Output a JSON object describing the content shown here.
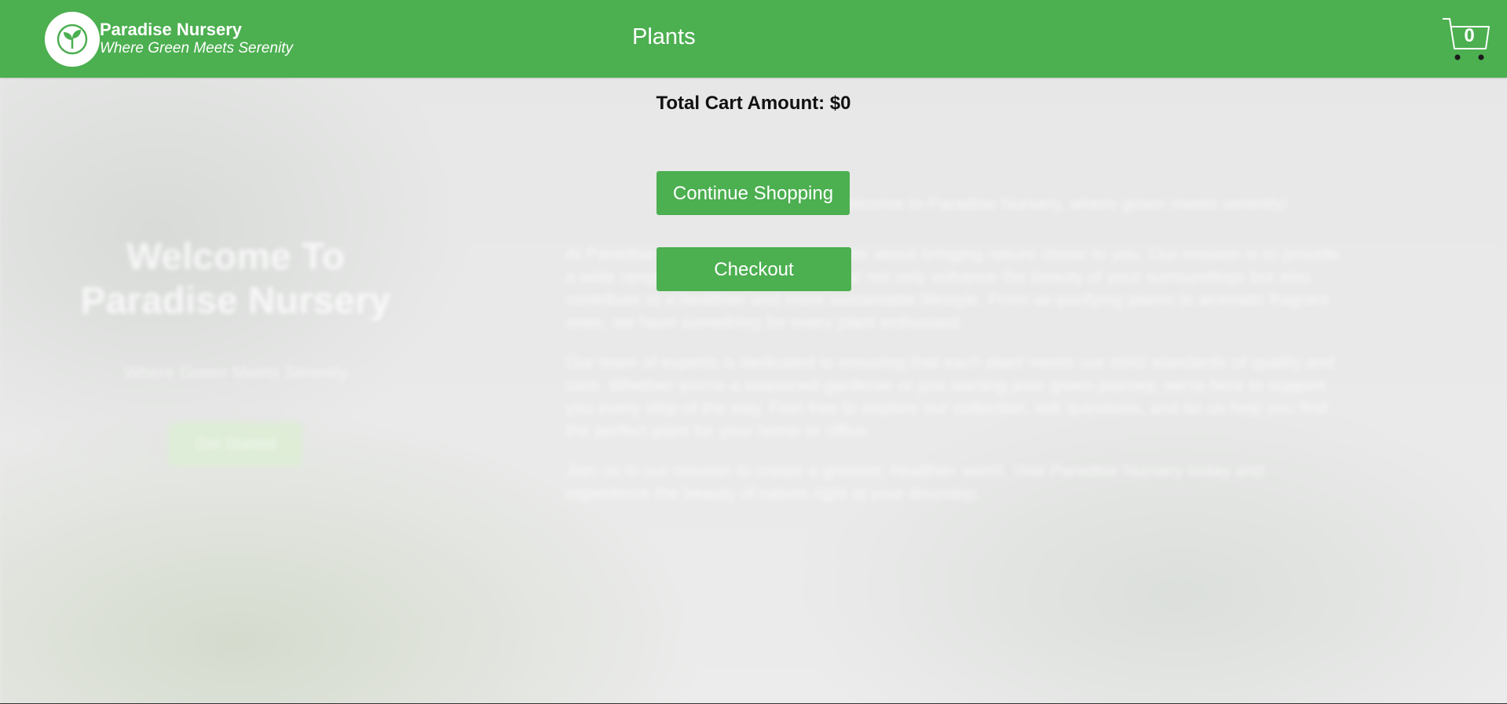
{
  "header": {
    "brand_name": "Paradise Nursery",
    "brand_tagline": "Where Green Meets Serenity",
    "nav_plants": "Plants",
    "cart_count": "0",
    "logo_icon": "seedling-icon",
    "cart_icon": "shopping-cart-icon",
    "color": "#4caf50"
  },
  "cart": {
    "total_label": "Total Cart Amount: $0",
    "continue_label": "Continue Shopping",
    "checkout_label": "Checkout",
    "button_color": "#4caf50"
  },
  "background": {
    "welcome": "Welcome To Paradise Nursery",
    "tagline": "Where Green Meets Serenity",
    "get_started": "Get Started",
    "intro": "Welcome to Paradise Nursery, where green meets serenity!",
    "paragraphs": [
      "At Paradise Nursery, we are passionate about bringing nature closer to you. Our mission is to provide a wide range of high-quality plants that not only enhance the beauty of your surroundings but also contribute to a healthier and more sustainable lifestyle. From air-purifying plants to aromatic fragrant ones, we have something for every plant enthusiast.",
      "Our team of experts is dedicated to ensuring that each plant meets our strict standards of quality and care. Whether you're a seasoned gardener or just starting your green journey, we're here to support you every step of the way. Feel free to explore our collection, ask questions, and let us help you find the perfect plant for your home or office.",
      "Join us in our mission to create a greener, healthier world. Visit Paradise Nursery today and experience the beauty of nature right at your doorstep."
    ]
  }
}
